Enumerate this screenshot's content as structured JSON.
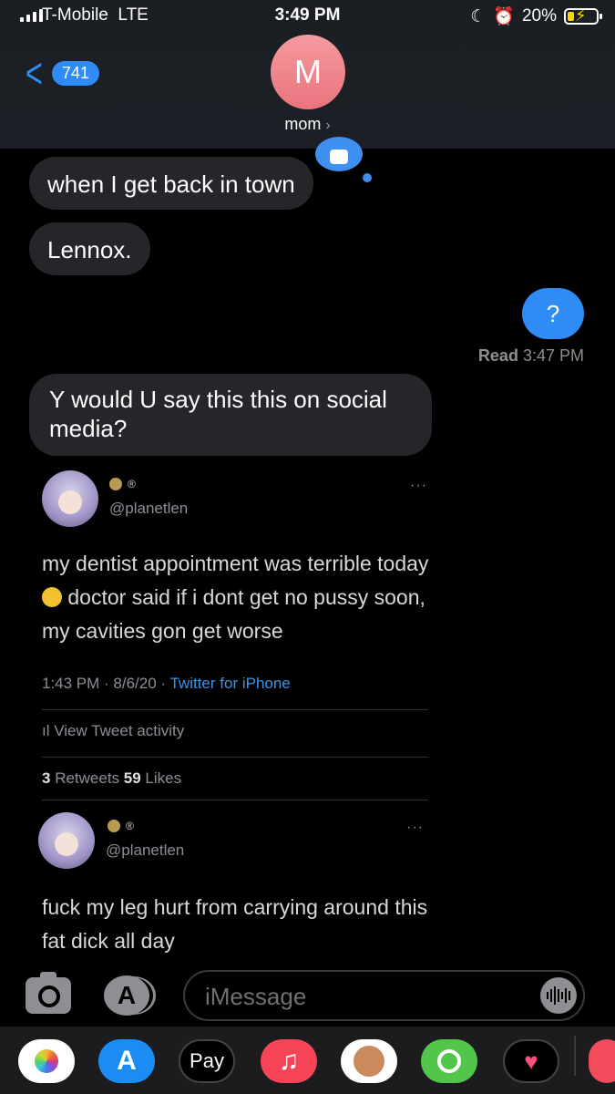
{
  "status_bar": {
    "carrier": "T-Mobile",
    "network": "LTE",
    "time": "3:49 PM",
    "battery_percent": "20%",
    "battery_level": 0.2,
    "icons": [
      "signal-bars-icon",
      "do-not-disturb-moon-icon",
      "alarm-icon",
      "battery-charging-icon"
    ]
  },
  "header": {
    "back_count": "741",
    "avatar_initial": "M",
    "contact_name": "mom",
    "contact_chevron": "›",
    "avatar_color": "#ef858c"
  },
  "messages": [
    {
      "direction": "incoming",
      "text": "when I get back in town"
    },
    {
      "direction": "incoming",
      "text": "Lennox."
    },
    {
      "direction": "outgoing",
      "text": "?"
    },
    {
      "direction": "incoming",
      "text": "Y would U say this this on social media?"
    }
  ],
  "read_receipt": {
    "label": "Read",
    "time": "3:47 PM"
  },
  "tweets": [
    {
      "handle": "@planetlen",
      "badge": "®",
      "more": "···",
      "text_part1": "my dentist appointment was terrible today",
      "text_part2": "doctor said if i dont get no pussy soon, my cavities gon get worse",
      "timestamp": "1:43 PM · 8/6/20 · ",
      "source": "Twitter for iPhone",
      "activity": "View Tweet activity",
      "retweets_count": "3",
      "retweets_label": " Retweets ",
      "likes_count": "59",
      "likes_label": " Likes"
    },
    {
      "handle": "@planetlen",
      "badge": "®",
      "more": "···",
      "text": "fuck my leg hurt from carrying around this fat dick all day"
    }
  ],
  "input": {
    "placeholder": "iMessage",
    "app_store_glyph": "A"
  },
  "app_strip": {
    "apple_pay_label": "Pay",
    "apps": [
      "photos-app-icon",
      "app-store-icon",
      "apple-pay-icon",
      "music-app-icon",
      "memoji-icon",
      "fitness-app-icon",
      "heart-app-icon",
      "web-app-icon"
    ]
  },
  "colors": {
    "imessage_blue": "#2f8cf5",
    "incoming_bubble": "#26252a",
    "twitter_link": "#3b93e6"
  }
}
